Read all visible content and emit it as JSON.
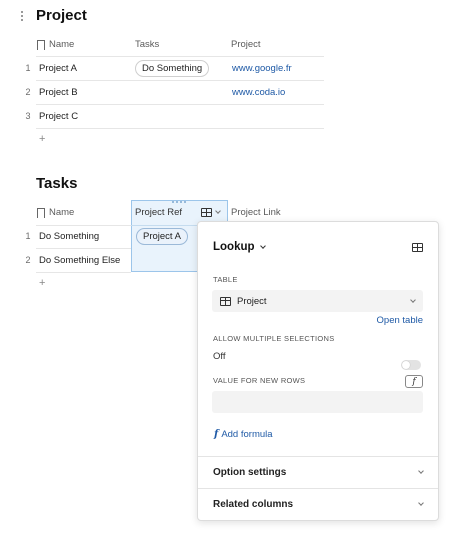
{
  "project_table": {
    "title": "Project",
    "columns": [
      "Name",
      "Tasks",
      "Project"
    ],
    "rows": [
      {
        "num": "1",
        "name": "Project A",
        "task_chip": "Do Something",
        "link": "www.google.fr"
      },
      {
        "num": "2",
        "name": "Project B",
        "task_chip": "",
        "link": "www.coda.io"
      },
      {
        "num": "3",
        "name": "Project C",
        "task_chip": "",
        "link": ""
      }
    ],
    "add_row": "+"
  },
  "tasks_table": {
    "title": "Tasks",
    "columns": [
      "Name",
      "Project Ref",
      "Project Link"
    ],
    "rows": [
      {
        "num": "1",
        "name": "Do Something",
        "ref_chip": "Project A"
      },
      {
        "num": "2",
        "name": "Do Something Else",
        "ref_chip": ""
      }
    ],
    "add_row": "+"
  },
  "column_panel": {
    "type_label": "Lookup",
    "table_label": "TABLE",
    "table_value": "Project",
    "open_table": "Open table",
    "allow_multiple_label": "ALLOW MULTIPLE SELECTIONS",
    "allow_multiple_value": "Off",
    "new_rows_label": "VALUE FOR NEW ROWS",
    "new_rows_value": "",
    "add_formula": "Add formula",
    "option_settings": "Option settings",
    "related_columns": "Related columns"
  },
  "icons": {
    "fx": "f",
    "formula": "f"
  },
  "colors": {
    "link": "#1f5aa6",
    "selected_column_bg": "#e9f3fc",
    "selected_column_border": "#9cc5ea"
  }
}
